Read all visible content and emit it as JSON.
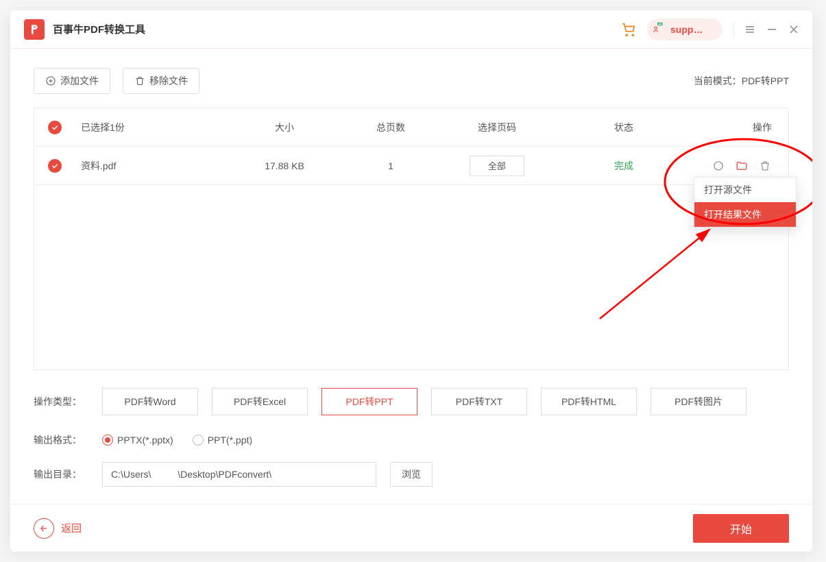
{
  "app": {
    "title": "百事牛PDF转换工具",
    "user": "supp…"
  },
  "toolbar": {
    "add": "添加文件",
    "remove": "移除文件",
    "mode_prefix": "当前模式：",
    "mode_value": "PDF转PPT"
  },
  "table": {
    "head": {
      "selected": "已选择1份",
      "size": "大小",
      "pages": "总页数",
      "range": "选择页码",
      "status": "状态",
      "actions": "操作"
    },
    "rows": [
      {
        "name": "资料.pdf",
        "size": "17.88 KB",
        "pages": "1",
        "range": "全部",
        "status": "完成"
      }
    ],
    "menu": {
      "open_source": "打开源文件",
      "open_result": "打开结果文件"
    }
  },
  "options": {
    "type_label": "操作类型：",
    "types": [
      "PDF转Word",
      "PDF转Excel",
      "PDF转PPT",
      "PDF转TXT",
      "PDF转HTML",
      "PDF转图片"
    ],
    "active_type_index": 2,
    "format_label": "输出格式：",
    "formats": [
      "PPTX(*.pptx)",
      "PPT(*.ppt)"
    ],
    "active_format_index": 0,
    "dir_label": "输出目录：",
    "dir_value": "C:\\Users\\          \\Desktop\\PDFconvert\\",
    "browse": "浏览"
  },
  "footer": {
    "back": "返回",
    "start": "开始"
  }
}
